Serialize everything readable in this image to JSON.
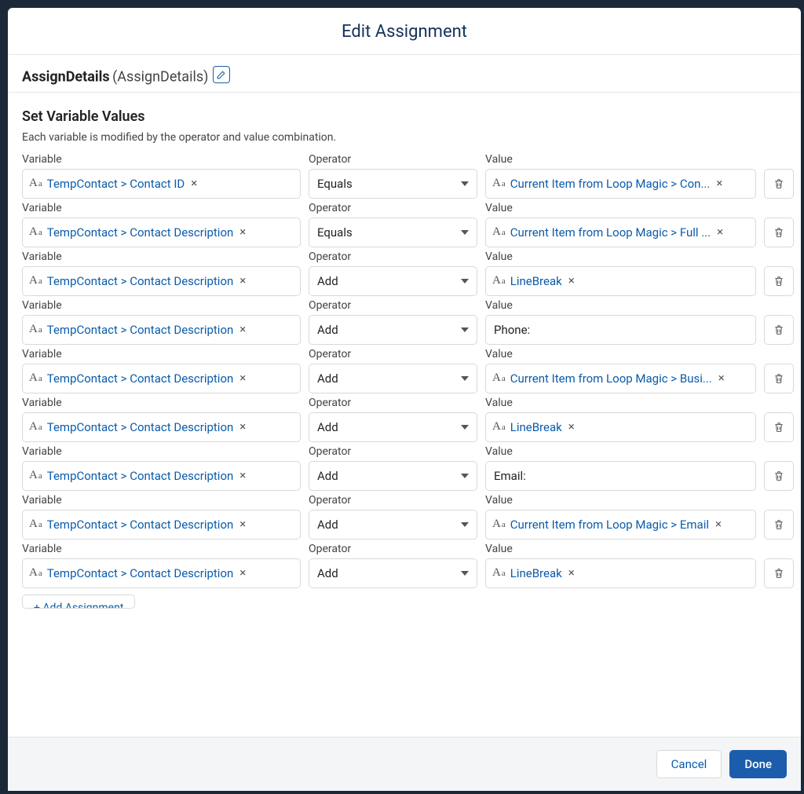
{
  "modal": {
    "title": "Edit Assignment"
  },
  "header": {
    "label": "AssignDetails",
    "api_name": "(AssignDetails)"
  },
  "section": {
    "title": "Set Variable Values",
    "help": "Each variable is modified by the operator and value combination."
  },
  "columns": {
    "variable": "Variable",
    "operator": "Operator",
    "value": "Value"
  },
  "footer": {
    "cancel": "Cancel",
    "done": "Done"
  },
  "add_button_label": "+ Add Assignment",
  "rows": [
    {
      "variable": "TempContact > Contact ID",
      "operator": "Equals",
      "value_kind": "ref",
      "value": "Current Item from Loop Magic > Con..."
    },
    {
      "variable": "TempContact > Contact Description",
      "operator": "Equals",
      "value_kind": "ref",
      "value": "Current Item from Loop Magic > Full ..."
    },
    {
      "variable": "TempContact > Contact Description",
      "operator": "Add",
      "value_kind": "ref",
      "value": "LineBreak"
    },
    {
      "variable": "TempContact > Contact Description",
      "operator": "Add",
      "value_kind": "text",
      "value": "Phone:"
    },
    {
      "variable": "TempContact > Contact Description",
      "operator": "Add",
      "value_kind": "ref",
      "value": "Current Item from Loop Magic > Busi..."
    },
    {
      "variable": "TempContact > Contact Description",
      "operator": "Add",
      "value_kind": "ref",
      "value": "LineBreak"
    },
    {
      "variable": "TempContact > Contact Description",
      "operator": "Add",
      "value_kind": "text",
      "value": "Email:"
    },
    {
      "variable": "TempContact > Contact Description",
      "operator": "Add",
      "value_kind": "ref",
      "value": "Current Item from Loop Magic > Email"
    },
    {
      "variable": "TempContact > Contact Description",
      "operator": "Add",
      "value_kind": "ref",
      "value": "LineBreak"
    }
  ]
}
